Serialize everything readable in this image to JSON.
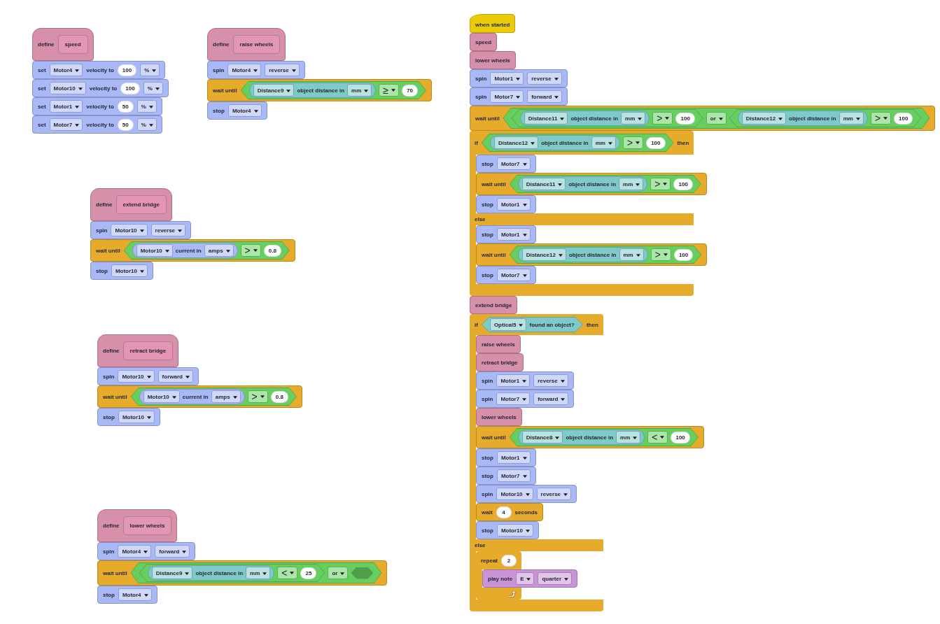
{
  "scripts": [
    {
      "blocks": [
        {
          "kind": "define",
          "color": "#d690aa",
          "parts": [
            {
              "kind": "label",
              "text": "define"
            },
            {
              "kind": "prototype",
              "text": "speed"
            }
          ]
        },
        {
          "kind": "stack",
          "color": "#a9b8f6",
          "parts": [
            {
              "kind": "label",
              "text": "set"
            },
            {
              "kind": "dropdown",
              "text": "Motor4"
            },
            {
              "kind": "label",
              "text": "velocity to"
            },
            {
              "kind": "number",
              "text": "100"
            },
            {
              "kind": "dropdown",
              "text": "%"
            }
          ]
        },
        {
          "kind": "stack",
          "color": "#a9b8f6",
          "parts": [
            {
              "kind": "label",
              "text": "set"
            },
            {
              "kind": "dropdown",
              "text": "Motor10"
            },
            {
              "kind": "label",
              "text": "velocity to"
            },
            {
              "kind": "number",
              "text": "100"
            },
            {
              "kind": "dropdown",
              "text": "%"
            }
          ]
        },
        {
          "kind": "stack",
          "color": "#a9b8f6",
          "parts": [
            {
              "kind": "label",
              "text": "set"
            },
            {
              "kind": "dropdown",
              "text": "Motor1"
            },
            {
              "kind": "label",
              "text": "velocity to"
            },
            {
              "kind": "number",
              "text": "50"
            },
            {
              "kind": "dropdown",
              "text": "%"
            }
          ]
        },
        {
          "kind": "stack",
          "color": "#a9b8f6",
          "parts": [
            {
              "kind": "label",
              "text": "set"
            },
            {
              "kind": "dropdown",
              "text": "Motor7"
            },
            {
              "kind": "label",
              "text": "velocity to"
            },
            {
              "kind": "number",
              "text": "50"
            },
            {
              "kind": "dropdown",
              "text": "%"
            }
          ]
        }
      ]
    },
    {
      "blocks": [
        {
          "kind": "define",
          "color": "#d690aa",
          "parts": [
            {
              "kind": "label",
              "text": "define"
            },
            {
              "kind": "prototype",
              "text": "raise wheels"
            }
          ]
        },
        {
          "kind": "stack",
          "color": "#a9b8f6",
          "parts": [
            {
              "kind": "label",
              "text": "spin"
            },
            {
              "kind": "dropdown",
              "text": "Motor4"
            },
            {
              "kind": "dropdown",
              "text": "reverse"
            }
          ]
        },
        {
          "kind": "stack",
          "color": "#e7ab2b",
          "parts": [
            {
              "kind": "label",
              "text": "wait until"
            },
            {
              "kind": "boolean",
              "color": "#66cf60",
              "parts": [
                {
                  "kind": "reporter",
                  "color": "#80c9c9",
                  "parts": [
                    {
                      "kind": "dropdown",
                      "text": "Distance9"
                    },
                    {
                      "kind": "label",
                      "text": "object distance in"
                    },
                    {
                      "kind": "dropdown",
                      "text": "mm"
                    }
                  ]
                },
                {
                  "kind": "operator",
                  "text": "≥"
                },
                {
                  "kind": "number",
                  "text": "70"
                }
              ]
            }
          ]
        },
        {
          "kind": "stack",
          "color": "#a9b8f6",
          "parts": [
            {
              "kind": "label",
              "text": "stop"
            },
            {
              "kind": "dropdown",
              "text": "Motor4"
            }
          ]
        }
      ]
    },
    {
      "blocks": [
        {
          "kind": "define",
          "color": "#d690aa",
          "parts": [
            {
              "kind": "label",
              "text": "define"
            },
            {
              "kind": "prototype",
              "text": "extend bridge"
            }
          ]
        },
        {
          "kind": "stack",
          "color": "#a9b8f6",
          "parts": [
            {
              "kind": "label",
              "text": "spin"
            },
            {
              "kind": "dropdown",
              "text": "Motor10"
            },
            {
              "kind": "dropdown",
              "text": "reverse"
            }
          ]
        },
        {
          "kind": "stack",
          "color": "#e7ab2b",
          "parts": [
            {
              "kind": "label",
              "text": "wait until"
            },
            {
              "kind": "boolean",
              "color": "#66cf60",
              "parts": [
                {
                  "kind": "reporter",
                  "color": "#a9b8f6",
                  "parts": [
                    {
                      "kind": "dropdown",
                      "text": "Motor10"
                    },
                    {
                      "kind": "label",
                      "text": "current in"
                    },
                    {
                      "kind": "dropdown",
                      "text": "amps"
                    }
                  ]
                },
                {
                  "kind": "operator",
                  "text": ">"
                },
                {
                  "kind": "number",
                  "text": "0.8"
                }
              ]
            }
          ]
        },
        {
          "kind": "stack",
          "color": "#a9b8f6",
          "parts": [
            {
              "kind": "label",
              "text": "stop"
            },
            {
              "kind": "dropdown",
              "text": "Motor10"
            }
          ]
        }
      ]
    },
    {
      "blocks": [
        {
          "kind": "define",
          "color": "#d690aa",
          "parts": [
            {
              "kind": "label",
              "text": "define"
            },
            {
              "kind": "prototype",
              "text": "retract bridge"
            }
          ]
        },
        {
          "kind": "stack",
          "color": "#a9b8f6",
          "parts": [
            {
              "kind": "label",
              "text": "spin"
            },
            {
              "kind": "dropdown",
              "text": "Motor10"
            },
            {
              "kind": "dropdown",
              "text": "forward"
            }
          ]
        },
        {
          "kind": "stack",
          "color": "#e7ab2b",
          "parts": [
            {
              "kind": "label",
              "text": "wait until"
            },
            {
              "kind": "boolean",
              "color": "#66cf60",
              "parts": [
                {
                  "kind": "reporter",
                  "color": "#a9b8f6",
                  "parts": [
                    {
                      "kind": "dropdown",
                      "text": "Motor10"
                    },
                    {
                      "kind": "label",
                      "text": "current in"
                    },
                    {
                      "kind": "dropdown",
                      "text": "amps"
                    }
                  ]
                },
                {
                  "kind": "operator",
                  "text": ">"
                },
                {
                  "kind": "number",
                  "text": "0.8"
                }
              ]
            }
          ]
        },
        {
          "kind": "stack",
          "color": "#a9b8f6",
          "parts": [
            {
              "kind": "label",
              "text": "stop"
            },
            {
              "kind": "dropdown",
              "text": "Motor10"
            }
          ]
        }
      ]
    },
    {
      "blocks": [
        {
          "kind": "define",
          "color": "#d690aa",
          "parts": [
            {
              "kind": "label",
              "text": "define"
            },
            {
              "kind": "prototype",
              "text": "lower wheels"
            }
          ]
        },
        {
          "kind": "stack",
          "color": "#a9b8f6",
          "parts": [
            {
              "kind": "label",
              "text": "spin"
            },
            {
              "kind": "dropdown",
              "text": "Motor4"
            },
            {
              "kind": "dropdown",
              "text": "forward"
            }
          ]
        },
        {
          "kind": "stack",
          "color": "#e7ab2b",
          "parts": [
            {
              "kind": "label",
              "text": "wait until"
            },
            {
              "kind": "boolean",
              "color": "#66cf60",
              "parts": [
                {
                  "kind": "boolean",
                  "color": "#66cf60",
                  "parts": [
                    {
                      "kind": "reporter",
                      "color": "#80c9c9",
                      "parts": [
                        {
                          "kind": "dropdown",
                          "text": "Distance9"
                        },
                        {
                          "kind": "label",
                          "text": "object distance in"
                        },
                        {
                          "kind": "dropdown",
                          "text": "mm"
                        }
                      ]
                    },
                    {
                      "kind": "operator",
                      "text": "<"
                    },
                    {
                      "kind": "number",
                      "text": "25"
                    }
                  ]
                },
                {
                  "kind": "dropdown",
                  "text": "or"
                },
                {
                  "kind": "slot"
                }
              ]
            }
          ]
        },
        {
          "kind": "stack",
          "color": "#a9b8f6",
          "parts": [
            {
              "kind": "label",
              "text": "stop"
            },
            {
              "kind": "dropdown",
              "text": "Motor4"
            }
          ]
        }
      ]
    },
    {
      "blocks": [
        {
          "kind": "hat",
          "color": "#ebcb07",
          "parts": [
            {
              "kind": "label",
              "text": "when started"
            }
          ]
        },
        {
          "kind": "stack",
          "color": "#d690aa",
          "parts": [
            {
              "kind": "label",
              "text": "speed"
            }
          ]
        },
        {
          "kind": "stack",
          "color": "#d690aa",
          "parts": [
            {
              "kind": "label",
              "text": "lower wheels"
            }
          ]
        },
        {
          "kind": "stack",
          "color": "#a9b8f6",
          "parts": [
            {
              "kind": "label",
              "text": "spin"
            },
            {
              "kind": "dropdown",
              "text": "Motor1"
            },
            {
              "kind": "dropdown",
              "text": "reverse"
            }
          ]
        },
        {
          "kind": "stack",
          "color": "#a9b8f6",
          "parts": [
            {
              "kind": "label",
              "text": "spin"
            },
            {
              "kind": "dropdown",
              "text": "Motor7"
            },
            {
              "kind": "dropdown",
              "text": "forward"
            }
          ]
        },
        {
          "kind": "stack",
          "color": "#e7ab2b",
          "parts": [
            {
              "kind": "label",
              "text": "wait until"
            },
            {
              "kind": "boolean",
              "color": "#66cf60",
              "parts": [
                {
                  "kind": "boolean",
                  "color": "#66cf60",
                  "parts": [
                    {
                      "kind": "reporter",
                      "color": "#80c9c9",
                      "parts": [
                        {
                          "kind": "dropdown",
                          "text": "Distance11"
                        },
                        {
                          "kind": "label",
                          "text": "object distance in"
                        },
                        {
                          "kind": "dropdown",
                          "text": "mm"
                        }
                      ]
                    },
                    {
                      "kind": "operator",
                      "text": ">"
                    },
                    {
                      "kind": "number",
                      "text": "100"
                    }
                  ]
                },
                {
                  "kind": "dropdown",
                  "text": "or"
                },
                {
                  "kind": "boolean",
                  "color": "#66cf60",
                  "parts": [
                    {
                      "kind": "reporter",
                      "color": "#80c9c9",
                      "parts": [
                        {
                          "kind": "dropdown",
                          "text": "Distance12"
                        },
                        {
                          "kind": "label",
                          "text": "object distance in"
                        },
                        {
                          "kind": "dropdown",
                          "text": "mm"
                        }
                      ]
                    },
                    {
                      "kind": "operator",
                      "text": ">"
                    },
                    {
                      "kind": "number",
                      "text": "100"
                    }
                  ]
                }
              ]
            }
          ]
        },
        {
          "kind": "if",
          "color": "#e7ab2b",
          "branches": [
            {
              "parts": [
                {
                  "kind": "label",
                  "text": "if"
                },
                {
                  "kind": "boolean",
                  "color": "#66cf60",
                  "parts": [
                    {
                      "kind": "reporter",
                      "color": "#80c9c9",
                      "parts": [
                        {
                          "kind": "dropdown",
                          "text": "Distance12"
                        },
                        {
                          "kind": "label",
                          "text": "object distance in"
                        },
                        {
                          "kind": "dropdown",
                          "text": "mm"
                        }
                      ]
                    },
                    {
                      "kind": "operator",
                      "text": ">"
                    },
                    {
                      "kind": "number",
                      "text": "100"
                    }
                  ]
                },
                {
                  "kind": "label",
                  "text": "then"
                }
              ],
              "blocks": [
                {
                  "kind": "stack",
                  "color": "#a9b8f6",
                  "parts": [
                    {
                      "kind": "label",
                      "text": "stop"
                    },
                    {
                      "kind": "dropdown",
                      "text": "Motor7"
                    }
                  ]
                },
                {
                  "kind": "stack",
                  "color": "#e7ab2b",
                  "parts": [
                    {
                      "kind": "label",
                      "text": "wait until"
                    },
                    {
                      "kind": "boolean",
                      "color": "#66cf60",
                      "parts": [
                        {
                          "kind": "reporter",
                          "color": "#80c9c9",
                          "parts": [
                            {
                              "kind": "dropdown",
                              "text": "Distance11"
                            },
                            {
                              "kind": "label",
                              "text": "object distance in"
                            },
                            {
                              "kind": "dropdown",
                              "text": "mm"
                            }
                          ]
                        },
                        {
                          "kind": "operator",
                          "text": ">"
                        },
                        {
                          "kind": "number",
                          "text": "100"
                        }
                      ]
                    }
                  ]
                },
                {
                  "kind": "stack",
                  "color": "#a9b8f6",
                  "parts": [
                    {
                      "kind": "label",
                      "text": "stop"
                    },
                    {
                      "kind": "dropdown",
                      "text": "Motor1"
                    }
                  ]
                }
              ]
            },
            {
              "parts": [
                {
                  "kind": "label",
                  "text": "else"
                }
              ],
              "blocks": [
                {
                  "kind": "stack",
                  "color": "#a9b8f6",
                  "parts": [
                    {
                      "kind": "label",
                      "text": "stop"
                    },
                    {
                      "kind": "dropdown",
                      "text": "Motor1"
                    }
                  ]
                },
                {
                  "kind": "stack",
                  "color": "#e7ab2b",
                  "parts": [
                    {
                      "kind": "label",
                      "text": "wait until"
                    },
                    {
                      "kind": "boolean",
                      "color": "#66cf60",
                      "parts": [
                        {
                          "kind": "reporter",
                          "color": "#80c9c9",
                          "parts": [
                            {
                              "kind": "dropdown",
                              "text": "Distance12"
                            },
                            {
                              "kind": "label",
                              "text": "object distance in"
                            },
                            {
                              "kind": "dropdown",
                              "text": "mm"
                            }
                          ]
                        },
                        {
                          "kind": "operator",
                          "text": ">"
                        },
                        {
                          "kind": "number",
                          "text": "100"
                        }
                      ]
                    }
                  ]
                },
                {
                  "kind": "stack",
                  "color": "#a9b8f6",
                  "parts": [
                    {
                      "kind": "label",
                      "text": "stop"
                    },
                    {
                      "kind": "dropdown",
                      "text": "Motor7"
                    }
                  ]
                }
              ]
            }
          ]
        },
        {
          "kind": "stack",
          "color": "#d690aa",
          "parts": [
            {
              "kind": "label",
              "text": "extend bridge"
            }
          ]
        },
        {
          "kind": "if",
          "color": "#e7ab2b",
          "branches": [
            {
              "parts": [
                {
                  "kind": "label",
                  "text": "if"
                },
                {
                  "kind": "boolean",
                  "color": "#80c9c9",
                  "parts": [
                    {
                      "kind": "dropdown",
                      "text": "Optical5"
                    },
                    {
                      "kind": "label",
                      "text": "found an object?"
                    }
                  ]
                },
                {
                  "kind": "label",
                  "text": "then"
                }
              ],
              "blocks": [
                {
                  "kind": "stack",
                  "color": "#d690aa",
                  "parts": [
                    {
                      "kind": "label",
                      "text": "raise wheels"
                    }
                  ]
                },
                {
                  "kind": "stack",
                  "color": "#d690aa",
                  "parts": [
                    {
                      "kind": "label",
                      "text": "retract bridge"
                    }
                  ]
                },
                {
                  "kind": "stack",
                  "color": "#a9b8f6",
                  "parts": [
                    {
                      "kind": "label",
                      "text": "spin"
                    },
                    {
                      "kind": "dropdown",
                      "text": "Motor1"
                    },
                    {
                      "kind": "dropdown",
                      "text": "reverse"
                    }
                  ]
                },
                {
                  "kind": "stack",
                  "color": "#a9b8f6",
                  "parts": [
                    {
                      "kind": "label",
                      "text": "spin"
                    },
                    {
                      "kind": "dropdown",
                      "text": "Motor7"
                    },
                    {
                      "kind": "dropdown",
                      "text": "forward"
                    }
                  ]
                },
                {
                  "kind": "stack",
                  "color": "#d690aa",
                  "parts": [
                    {
                      "kind": "label",
                      "text": "lower wheels"
                    }
                  ]
                },
                {
                  "kind": "stack",
                  "color": "#e7ab2b",
                  "parts": [
                    {
                      "kind": "label",
                      "text": "wait until"
                    },
                    {
                      "kind": "boolean",
                      "color": "#66cf60",
                      "parts": [
                        {
                          "kind": "reporter",
                          "color": "#80c9c9",
                          "parts": [
                            {
                              "kind": "dropdown",
                              "text": "Distance8"
                            },
                            {
                              "kind": "label",
                              "text": "object distance in"
                            },
                            {
                              "kind": "dropdown",
                              "text": "mm"
                            }
                          ]
                        },
                        {
                          "kind": "operator",
                          "text": "<"
                        },
                        {
                          "kind": "number",
                          "text": "100"
                        }
                      ]
                    }
                  ]
                },
                {
                  "kind": "stack",
                  "color": "#a9b8f6",
                  "parts": [
                    {
                      "kind": "label",
                      "text": "stop"
                    },
                    {
                      "kind": "dropdown",
                      "text": "Motor1"
                    }
                  ]
                },
                {
                  "kind": "stack",
                  "color": "#a9b8f6",
                  "parts": [
                    {
                      "kind": "label",
                      "text": "stop"
                    },
                    {
                      "kind": "dropdown",
                      "text": "Motor7"
                    }
                  ]
                },
                {
                  "kind": "stack",
                  "color": "#a9b8f6",
                  "parts": [
                    {
                      "kind": "label",
                      "text": "spin"
                    },
                    {
                      "kind": "dropdown",
                      "text": "Motor10"
                    },
                    {
                      "kind": "dropdown",
                      "text": "reverse"
                    }
                  ]
                },
                {
                  "kind": "stack",
                  "color": "#e7ab2b",
                  "parts": [
                    {
                      "kind": "label",
                      "text": "wait"
                    },
                    {
                      "kind": "number",
                      "text": "4"
                    },
                    {
                      "kind": "label",
                      "text": "seconds"
                    }
                  ]
                },
                {
                  "kind": "stack",
                  "color": "#a9b8f6",
                  "parts": [
                    {
                      "kind": "label",
                      "text": "stop"
                    },
                    {
                      "kind": "dropdown",
                      "text": "Motor10"
                    }
                  ]
                }
              ]
            },
            {
              "parts": [
                {
                  "kind": "label",
                  "text": "else"
                }
              ],
              "blocks": [
                {
                  "kind": "loop",
                  "color": "#e7ab2b",
                  "branches": [
                    {
                      "parts": [
                        {
                          "kind": "label",
                          "text": "repeat"
                        },
                        {
                          "kind": "number",
                          "text": "2"
                        }
                      ],
                      "blocks": [
                        {
                          "kind": "stack",
                          "color": "#c893d7",
                          "parts": [
                            {
                              "kind": "label",
                              "text": "play note"
                            },
                            {
                              "kind": "dropdown",
                              "text": "E"
                            },
                            {
                              "kind": "dropdown",
                              "text": "quarter"
                            }
                          ]
                        }
                      ]
                    }
                  ]
                }
              ]
            }
          ]
        }
      ]
    }
  ]
}
